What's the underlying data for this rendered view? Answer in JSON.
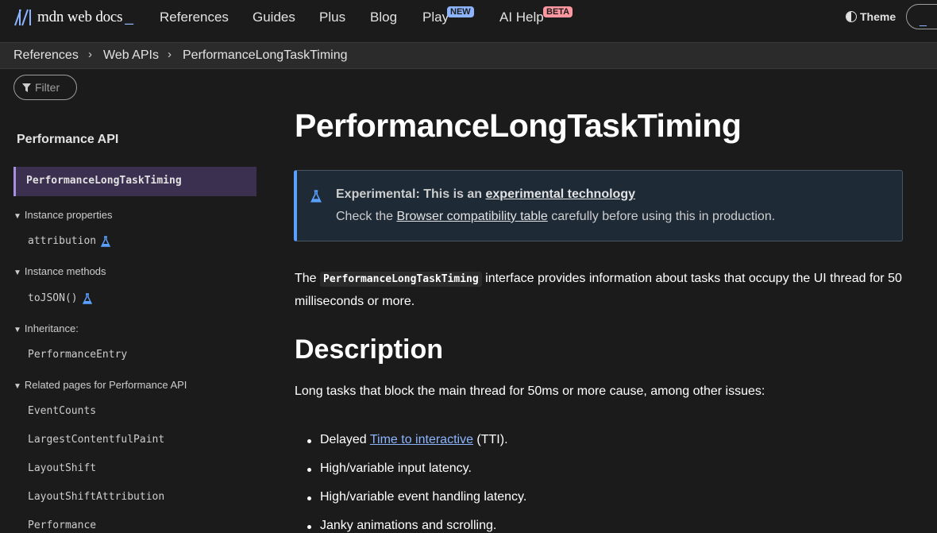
{
  "header": {
    "logo_text": "mdn web docs",
    "logo_cursor": "_",
    "nav": [
      {
        "label": "References"
      },
      {
        "label": "Guides"
      },
      {
        "label": "Plus"
      },
      {
        "label": "Blog"
      },
      {
        "label": "Play",
        "badge": "NEW"
      },
      {
        "label": "AI Help",
        "badge": "BETA"
      }
    ],
    "theme_label": "Theme",
    "search_glyph": "_"
  },
  "breadcrumb": [
    "References",
    "Web APIs",
    "PerformanceLongTaskTiming"
  ],
  "sidebar": {
    "filter_placeholder": "Filter",
    "heading": "Performance API",
    "active_item": "PerformanceLongTaskTiming",
    "groups": [
      {
        "label": "Instance properties",
        "items": [
          {
            "label": "attribution",
            "experimental": true
          }
        ]
      },
      {
        "label": "Instance methods",
        "items": [
          {
            "label": "toJSON()",
            "experimental": true
          }
        ]
      },
      {
        "label": "Inheritance:",
        "items": [
          {
            "label": "PerformanceEntry"
          }
        ]
      },
      {
        "label": "Related pages for Performance API",
        "items": [
          {
            "label": "EventCounts"
          },
          {
            "label": "LargestContentfulPaint"
          },
          {
            "label": "LayoutShift"
          },
          {
            "label": "LayoutShiftAttribution"
          },
          {
            "label": "Performance"
          }
        ]
      }
    ]
  },
  "main": {
    "title": "PerformanceLongTaskTiming",
    "notice": {
      "bold_prefix": "Experimental: This is an ",
      "bold_link": "experimental technology",
      "line2_prefix": "Check the ",
      "line2_link": "Browser compatibility table",
      "line2_suffix": " carefully before using this in production."
    },
    "intro": {
      "prefix": "The ",
      "code": "PerformanceLongTaskTiming",
      "suffix": " interface provides information about tasks that occupy the UI thread for 50 milliseconds or more."
    },
    "description_heading": "Description",
    "description_text": "Long tasks that block the main thread for 50ms or more cause, among other issues:",
    "bullets": [
      {
        "prefix": "Delayed ",
        "link": "Time to interactive",
        "suffix": " (TTI)."
      },
      {
        "text": "High/variable input latency."
      },
      {
        "text": "High/variable event handling latency."
      },
      {
        "text": "Janky animations and scrolling."
      }
    ]
  },
  "colors": {
    "accent_link": "#8cb4ff",
    "active_bg": "#3b3050",
    "notice_border": "#5aa0ff"
  }
}
